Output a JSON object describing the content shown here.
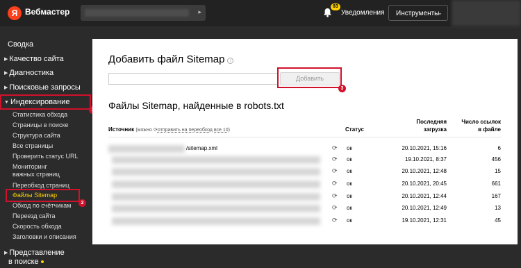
{
  "header": {
    "logo_letter": "Я",
    "app_name": "Вебмастер",
    "notifications_count": "83",
    "notifications_label": "Уведомления",
    "tools_label": "Инструменты"
  },
  "sidebar": {
    "items": [
      {
        "label": "Сводка"
      },
      {
        "label": "Качество сайта"
      },
      {
        "label": "Диагностика"
      },
      {
        "label": "Поисковые запросы"
      },
      {
        "label": "Индексирование"
      },
      {
        "label": "Представление"
      },
      {
        "label": "в поиске"
      }
    ],
    "subitems": [
      {
        "label": "Статистика обхода"
      },
      {
        "label": "Страницы в поиске"
      },
      {
        "label": "Структура сайта"
      },
      {
        "label": "Все страницы"
      },
      {
        "label": "Проверить статус URL"
      },
      {
        "label": "Мониторинг"
      },
      {
        "label": "важных страниц"
      },
      {
        "label": "Переобход страниц"
      },
      {
        "label": "Файлы Sitemap"
      },
      {
        "label": "Обход по счётчикам"
      },
      {
        "label": "Переезд сайта"
      },
      {
        "label": "Скорость обхода"
      },
      {
        "label": "Заголовки и описания"
      }
    ]
  },
  "markers": [
    "1",
    "2",
    "3"
  ],
  "main": {
    "title": "Добавить файл Sitemap",
    "info_icon": "i",
    "add_button": "Добавить",
    "section_title": "Файлы Sitemap, найденные в robots.txt",
    "table": {
      "col_source": "Источник",
      "col_source_note_pre": "(можно",
      "col_source_note_link": "отправить на переобход все 10)",
      "col_status": "Статус",
      "col_last_1": "Последняя",
      "col_last_2": "загрузка",
      "col_links_1": "Число ссылок",
      "col_links_2": "в файле",
      "rows": [
        {
          "source": "/sitemap.xml",
          "status": "ок",
          "date": "20.10.2021, 15:16",
          "count": "6"
        },
        {
          "source": "",
          "status": "ок",
          "date": "19.10.2021, 8:37",
          "count": "456"
        },
        {
          "source": "",
          "status": "ок",
          "date": "20.10.2021, 12:48",
          "count": "15"
        },
        {
          "source": "",
          "status": "ок",
          "date": "20.10.2021, 20:45",
          "count": "661"
        },
        {
          "source": "",
          "status": "ок",
          "date": "20.10.2021, 12:44",
          "count": "167"
        },
        {
          "source": "",
          "status": "ок",
          "date": "20.10.2021, 12:49",
          "count": "13"
        },
        {
          "source": "",
          "status": "ок",
          "date": "19.10.2021, 12:31",
          "count": "45"
        }
      ]
    }
  },
  "colors": {
    "accent": "#ffd200",
    "highlight": "#d0112b",
    "logo": "#fc3f1d"
  }
}
